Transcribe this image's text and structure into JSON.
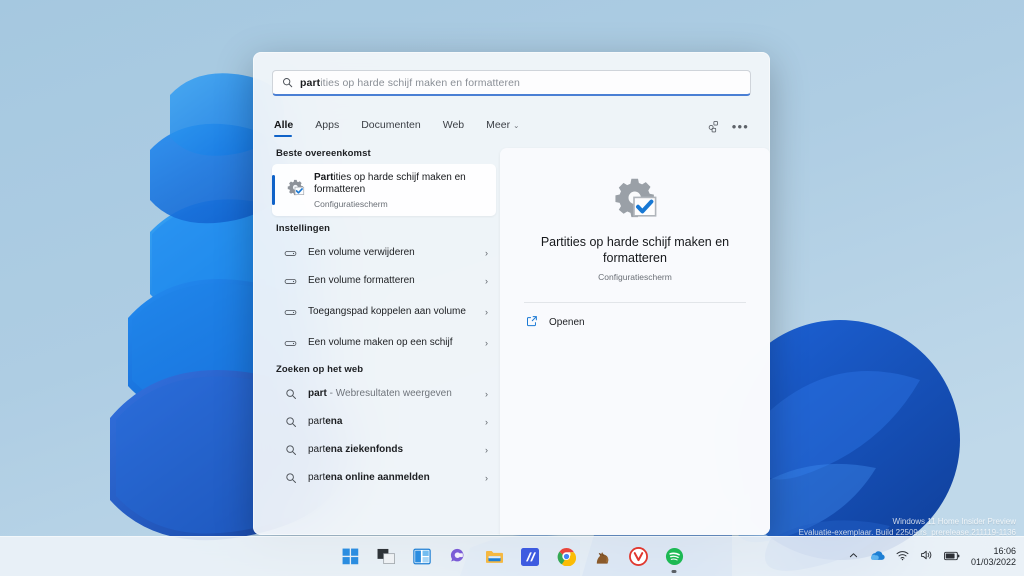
{
  "desktop": {
    "watermark_line1": "Windows 11 Home Insider Preview",
    "watermark_line2": "Evaluatie-exemplaar. Build 22509.rs_prerelease.211119-1136"
  },
  "search": {
    "typed": "part",
    "suggestion": "ities op harde schijf maken en formatteren",
    "icon": "search-icon",
    "tabs": [
      {
        "label": "Alle",
        "active": true
      },
      {
        "label": "Apps",
        "active": false
      },
      {
        "label": "Documenten",
        "active": false
      },
      {
        "label": "Web",
        "active": false
      },
      {
        "label": "Meer",
        "active": false,
        "chevron": "⌄"
      }
    ],
    "actions": {
      "share_icon": "people-share-icon",
      "more_icon": "ellipsis-icon",
      "more_label": "•••"
    },
    "sections": {
      "best_match_heading": "Beste overeenkomst",
      "settings_heading": "Instellingen",
      "web_heading": "Zoeken op het web"
    },
    "best_match": {
      "title_bold": "Part",
      "title_rest": "ities op harde schijf maken en formatteren",
      "subtitle": "Configuratiescherm",
      "icon": "control-panel-gear-check-icon"
    },
    "settings_results": [
      {
        "label": "Een volume verwijderen",
        "icon": "disk-drive-icon",
        "chevron": "›"
      },
      {
        "label": "Een volume formatteren",
        "icon": "disk-drive-icon",
        "chevron": "›"
      },
      {
        "label": "Toegangspad koppelen aan volume",
        "icon": "disk-drive-icon",
        "chevron": "›"
      },
      {
        "label": "Een volume maken op een schijf",
        "icon": "disk-drive-icon",
        "chevron": "›"
      }
    ],
    "web_results": [
      {
        "bold": "part",
        "rest": " - Webresultaten weergeven",
        "rest_muted": true,
        "icon": "search-icon",
        "chevron": "›"
      },
      {
        "prefix": "part",
        "bold": "ena",
        "icon": "search-icon",
        "chevron": "›"
      },
      {
        "prefix": "part",
        "bold": "ena ziekenfonds",
        "icon": "search-icon",
        "chevron": "›"
      },
      {
        "prefix": "part",
        "bold": "ena online aanmelden",
        "icon": "search-icon",
        "chevron": "›"
      }
    ],
    "preview": {
      "title": "Partities op harde schijf maken en formatteren",
      "subtitle": "Configuratiescherm",
      "open_label": "Openen",
      "open_icon": "external-link-icon",
      "app_icon": "control-panel-gear-check-icon"
    }
  },
  "taskbar": {
    "apps": [
      {
        "name": "start-button",
        "icon": "windows-logo-icon",
        "running": false
      },
      {
        "name": "task-view-button",
        "icon": "task-view-icon",
        "running": false
      },
      {
        "name": "widgets-button",
        "icon": "widgets-icon",
        "running": false
      },
      {
        "name": "chat-button",
        "icon": "teams-chat-icon",
        "running": false
      },
      {
        "name": "file-explorer-button",
        "icon": "folder-icon",
        "running": false
      },
      {
        "name": "app-m-button",
        "icon": "blue-m-app-icon",
        "running": false
      },
      {
        "name": "chrome-button",
        "icon": "chrome-icon",
        "running": false
      },
      {
        "name": "horse-app-button",
        "icon": "horse-icon",
        "running": false
      },
      {
        "name": "vivaldi-button",
        "icon": "vivaldi-icon",
        "running": false
      },
      {
        "name": "spotify-button",
        "icon": "spotify-icon",
        "running": true
      }
    ],
    "tray": {
      "overflow_icon": "chevron-up-icon",
      "onedrive_icon": "onedrive-cloud-icon",
      "wifi_icon": "wifi-icon",
      "volume_icon": "speaker-icon",
      "battery_icon": "battery-icon",
      "time": "16:06",
      "date": "01/03/2022"
    }
  },
  "colors": {
    "accent": "#0f62c8",
    "panel": "#f3f6fa",
    "text": "#16181b",
    "muted": "#6a6f76"
  }
}
